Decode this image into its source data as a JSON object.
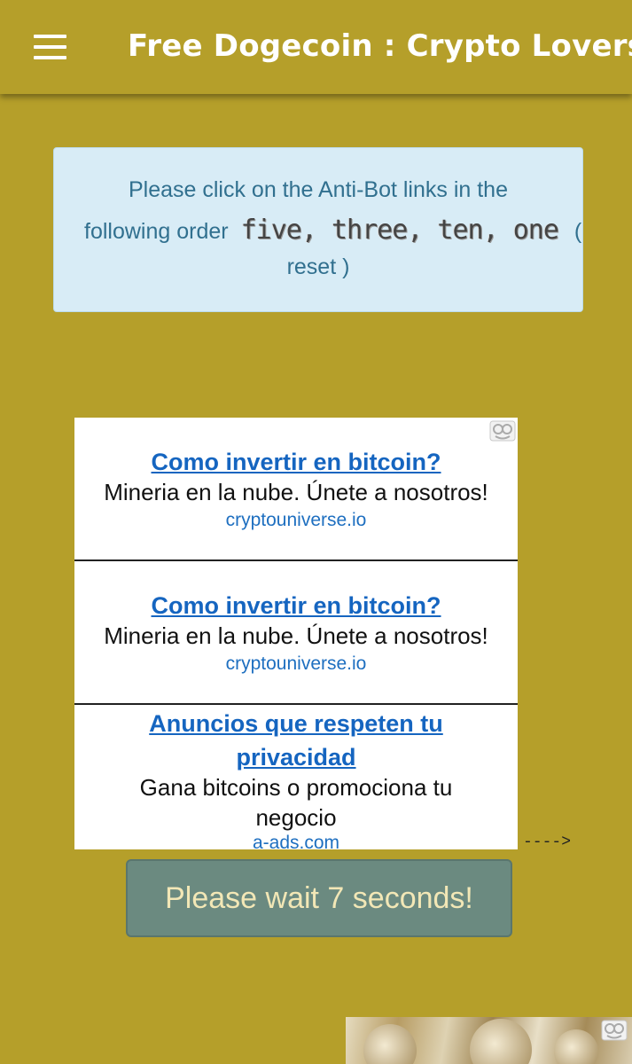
{
  "app": {
    "title": "Free Dogecoin : Crypto Lovers",
    "menu_icon": "hamburger-menu-icon"
  },
  "antibot": {
    "line1": "Please click on the Anti-Bot links in the",
    "line2_prefix": "following order",
    "order_captcha": "five, three, ten, one",
    "open_paren": "(",
    "reset_label": "reset",
    "close_paren": ")"
  },
  "ads": [
    {
      "title": "Como invertir en bitcoin?",
      "description": "Mineria en la nube. Únete a nosotros!",
      "url": "cryptouniverse.io"
    },
    {
      "title": "Como invertir en bitcoin?",
      "description": "Mineria en la nube. Únete a nosotros!",
      "url": "cryptouniverse.io"
    },
    {
      "title": "Anuncios que respeten tu privacidad",
      "description": "Gana bitcoins o promociona tu negocio",
      "url": "a-ads.com"
    }
  ],
  "arrow_text": "---->",
  "wait_button": "Please wait 7 seconds!",
  "colors": {
    "background": "#b59f2a",
    "alert_bg": "#d8ecf6",
    "alert_text": "#31708f",
    "ad_link": "#1565c0",
    "wait_button_bg": "#6b8a80"
  }
}
